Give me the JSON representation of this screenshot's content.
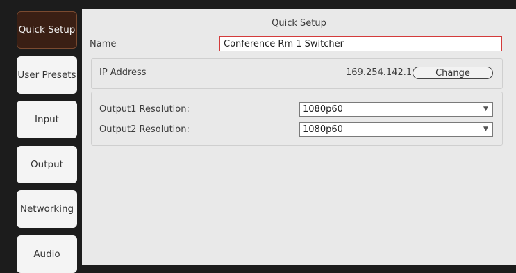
{
  "sidebar": {
    "items": [
      {
        "label": "Quick Setup",
        "active": true
      },
      {
        "label": "User Presets",
        "active": false
      },
      {
        "label": "Input",
        "active": false
      },
      {
        "label": "Output",
        "active": false
      },
      {
        "label": "Networking",
        "active": false
      },
      {
        "label": "Audio",
        "active": false
      }
    ]
  },
  "main": {
    "title": "Quick Setup",
    "name_label": "Name",
    "name_value": "Conference Rm 1 Switcher",
    "ip_label": "IP Address",
    "ip_value": "169.254.142.1",
    "change_button": "Change",
    "output1_label": "Output1 Resolution:",
    "output1_value": "1080p60",
    "output2_label": "Output2 Resolution:",
    "output2_value": "1080p60",
    "dropdown_arrow": "▼"
  },
  "colors": {
    "active_tab": "#3a1f14",
    "panel": "#e9e9e9",
    "name_field_border": "#d33b3b"
  }
}
